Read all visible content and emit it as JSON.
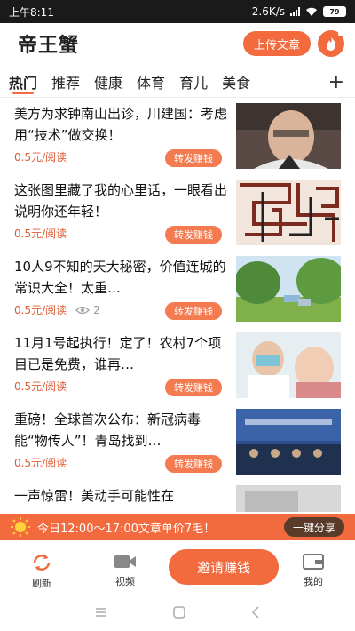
{
  "status_bar": {
    "time": "上午8:11",
    "speed": "2.6K/s",
    "battery": "79"
  },
  "header": {
    "app_title": "帝王蟹",
    "upload_label": "上传文章",
    "fire_icon": "fire-icon"
  },
  "tabs": [
    {
      "label": "热门",
      "active": true
    },
    {
      "label": "推荐",
      "active": false
    },
    {
      "label": "健康",
      "active": false
    },
    {
      "label": "体育",
      "active": false
    },
    {
      "label": "育儿",
      "active": false
    },
    {
      "label": "美食",
      "active": false
    }
  ],
  "tab_add": "+",
  "articles": [
    {
      "title": "美方为求钟南山出诊，川建国：考虑用“技术”做交换！",
      "price": "0.5元/阅读",
      "views": "",
      "share_label": "转发赚钱"
    },
    {
      "title": "这张图里藏了我的心里话，一眼看出说明你还年轻！",
      "price": "0.5元/阅读",
      "views": "",
      "share_label": "转发赚钱"
    },
    {
      "title": "10人9不知的天大秘密，价值连城的常识大全！太重…",
      "price": "0.5元/阅读",
      "views": "2",
      "share_label": "转发赚钱"
    },
    {
      "title": "11月1号起执行！定了！农村7个项目已是免费，谁再…",
      "price": "0.5元/阅读",
      "views": "",
      "share_label": "转发赚钱"
    },
    {
      "title": "重磅！全球首次公布：新冠病毒能“物传人”！青岛找到…",
      "price": "0.5元/阅读",
      "views": "",
      "share_label": "转发赚钱"
    },
    {
      "title": "一声惊雷！美动手可能性在",
      "price": "",
      "views": "",
      "share_label": ""
    }
  ],
  "promo": {
    "text": "今日12:00～17:00文章单价7毛！",
    "button": "一键分享"
  },
  "bottom_nav": {
    "refresh": "刷新",
    "video": "视频",
    "invite": "邀请赚钱",
    "mine": "我的"
  },
  "colors": {
    "accent": "#f26a3d",
    "price": "#e05a33"
  }
}
